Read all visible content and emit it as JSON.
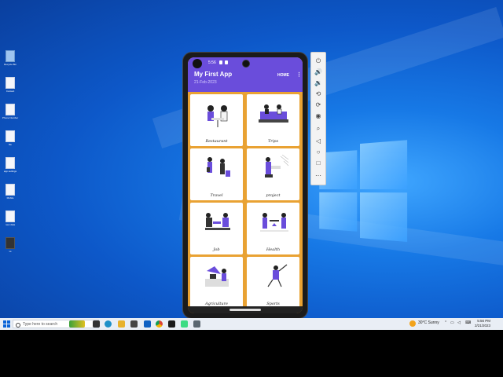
{
  "desktop": {
    "icons": [
      {
        "label": "Recycle Bin",
        "icon": "recycle-bin-icon"
      },
      {
        "label": "Contact",
        "icon": "file-icon"
      },
      {
        "label": "Phone Number",
        "icon": "file-icon"
      },
      {
        "label": "file",
        "icon": "file-icon"
      },
      {
        "label": "app settings",
        "icon": "file-icon"
      },
      {
        "label": "Mobile",
        "icon": "file-icon"
      },
      {
        "label": "new data",
        "icon": "file-icon"
      },
      {
        "label": "vs",
        "icon": "file-icon"
      }
    ]
  },
  "phone": {
    "status_time": "5:56",
    "app_title": "My First App",
    "app_date": "21-Feb-2023",
    "menu_home": "HOME",
    "overflow_symbol": "⋮",
    "accent_color": "#6a4ddb",
    "background_color": "#e9a233",
    "cards": [
      {
        "label": "Restaurant",
        "icon": "restaurant-illustration-icon"
      },
      {
        "label": "Trips",
        "icon": "trips-illustration-icon"
      },
      {
        "label": "Travel",
        "icon": "travel-illustration-icon"
      },
      {
        "label": "project",
        "icon": "project-illustration-icon"
      },
      {
        "label": "Job",
        "icon": "job-illustration-icon"
      },
      {
        "label": "Health",
        "icon": "health-illustration-icon"
      },
      {
        "label": "Agriculture",
        "icon": "agriculture-illustration-icon"
      },
      {
        "label": "Sports",
        "icon": "sports-illustration-icon"
      }
    ]
  },
  "emulator_toolbar": {
    "tools": [
      "power-icon",
      "volume-up-icon",
      "volume-down-icon",
      "rotate-left-icon",
      "rotate-right-icon",
      "camera-icon",
      "zoom-icon",
      "back-icon",
      "home-icon",
      "overview-icon",
      "more-icon"
    ]
  },
  "taskbar": {
    "search_placeholder": "Type here to search",
    "weather": "30°C  Sunny",
    "time": "5:56 PM",
    "date": "2/21/2023"
  }
}
